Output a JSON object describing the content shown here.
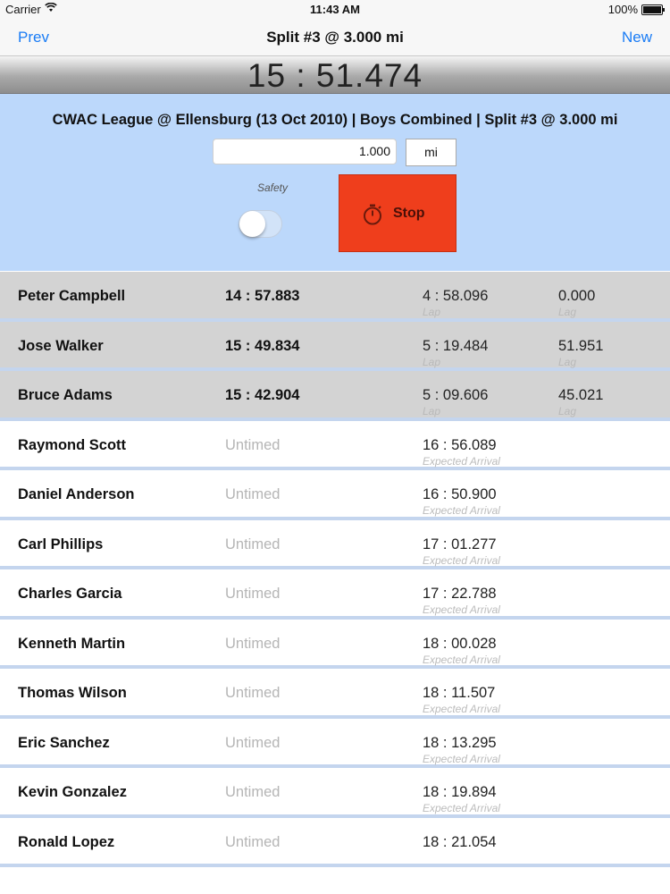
{
  "status_bar": {
    "carrier": "Carrier",
    "time": "11:43 AM",
    "battery": "100%"
  },
  "nav": {
    "prev": "Prev",
    "title": "Split #3 @ 3.000 mi",
    "new": "New"
  },
  "clock": "15 : 51.474",
  "panel": {
    "meet_title": "CWAC League @ Ellensburg (13 Oct 2010) | Boys Combined | Split #3 @ 3.000 mi",
    "distance_value": "1.000",
    "unit": "mi",
    "safety_label": "Safety",
    "safety_on": false,
    "stop_label": "Stop",
    "stop_color": "#ef3e1c"
  },
  "runners": [
    {
      "name": "Peter Campbell",
      "split": "14 : 57.883",
      "col3": "4 : 58.096",
      "col3_sub": "Lap",
      "col4": "0.000",
      "col4_sub": "Lag",
      "timed": true
    },
    {
      "name": "Jose Walker",
      "split": "15 : 49.834",
      "col3": "5 : 19.484",
      "col3_sub": "Lap",
      "col4": "51.951",
      "col4_sub": "Lag",
      "timed": true
    },
    {
      "name": "Bruce Adams",
      "split": "15 : 42.904",
      "col3": "5 : 09.606",
      "col3_sub": "Lap",
      "col4": "45.021",
      "col4_sub": "Lag",
      "timed": true
    },
    {
      "name": "Raymond Scott",
      "split": "Untimed",
      "col3": "16 : 56.089",
      "col3_sub": "Expected Arrival",
      "col4": "",
      "col4_sub": "",
      "timed": false
    },
    {
      "name": "Daniel Anderson",
      "split": "Untimed",
      "col3": "16 : 50.900",
      "col3_sub": "Expected Arrival",
      "col4": "",
      "col4_sub": "",
      "timed": false
    },
    {
      "name": "Carl Phillips",
      "split": "Untimed",
      "col3": "17 : 01.277",
      "col3_sub": "Expected Arrival",
      "col4": "",
      "col4_sub": "",
      "timed": false
    },
    {
      "name": "Charles Garcia",
      "split": "Untimed",
      "col3": "17 : 22.788",
      "col3_sub": "Expected Arrival",
      "col4": "",
      "col4_sub": "",
      "timed": false
    },
    {
      "name": "Kenneth Martin",
      "split": "Untimed",
      "col3": "18 : 00.028",
      "col3_sub": "Expected Arrival",
      "col4": "",
      "col4_sub": "",
      "timed": false
    },
    {
      "name": "Thomas Wilson",
      "split": "Untimed",
      "col3": "18 : 11.507",
      "col3_sub": "Expected Arrival",
      "col4": "",
      "col4_sub": "",
      "timed": false
    },
    {
      "name": "Eric Sanchez",
      "split": "Untimed",
      "col3": "18 : 13.295",
      "col3_sub": "Expected Arrival",
      "col4": "",
      "col4_sub": "",
      "timed": false
    },
    {
      "name": "Kevin Gonzalez",
      "split": "Untimed",
      "col3": "18 : 19.894",
      "col3_sub": "Expected Arrival",
      "col4": "",
      "col4_sub": "",
      "timed": false
    },
    {
      "name": "Ronald Lopez",
      "split": "Untimed",
      "col3": "18 : 21.054",
      "col3_sub": "",
      "col4": "",
      "col4_sub": "",
      "timed": false
    }
  ]
}
